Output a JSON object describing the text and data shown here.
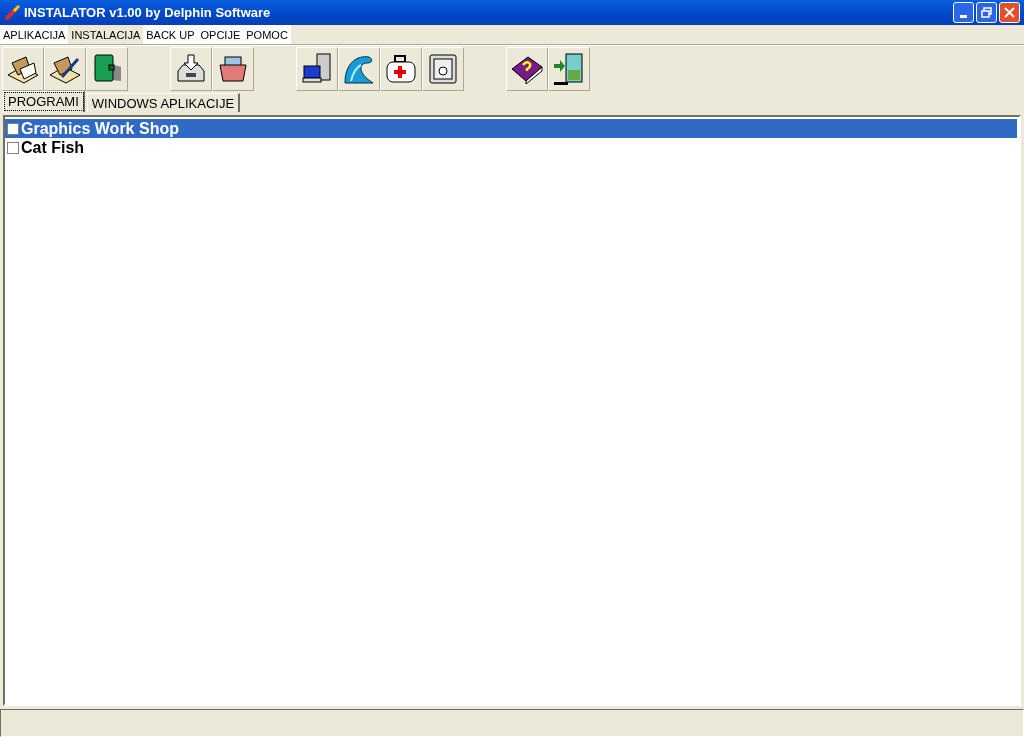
{
  "window": {
    "title": "INSTALATOR v1.00 by Delphin Software"
  },
  "menu": [
    {
      "label": "APLIKACIJA",
      "selected": false
    },
    {
      "label": "INSTALACIJA",
      "selected": true
    },
    {
      "label": "BACK UP",
      "selected": false
    },
    {
      "label": "OPCIJE",
      "selected": false
    },
    {
      "label": "POMOC",
      "selected": false
    }
  ],
  "tabs": [
    {
      "label": "PROGRAMI",
      "selected": true
    },
    {
      "label": "WINDOWS APLIKACIJE",
      "selected": false
    }
  ],
  "programs": [
    {
      "name": "Graphics Work Shop",
      "checked": false,
      "selected": true
    },
    {
      "name": "Cat Fish",
      "checked": false,
      "selected": false
    }
  ]
}
